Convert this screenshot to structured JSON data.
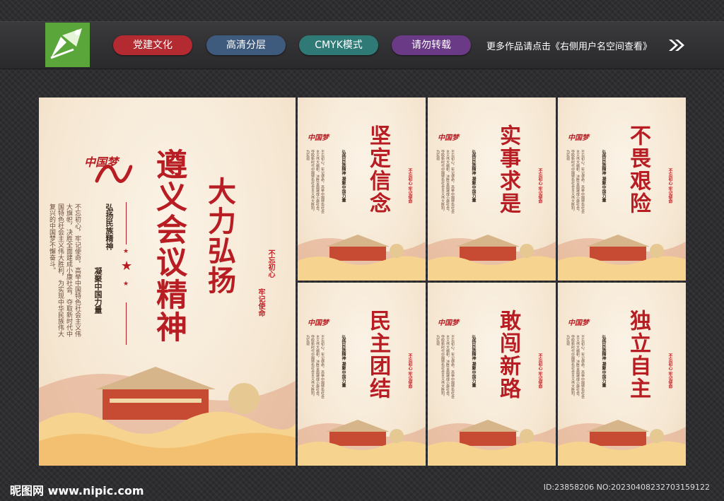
{
  "header": {
    "tags": [
      {
        "label": "党建文化",
        "color": "#b32a30"
      },
      {
        "label": "高清分层",
        "color": "#3e5a7d"
      },
      {
        "label": "CMYK模式",
        "color": "#2f7a77"
      },
      {
        "label": "请勿转载",
        "color": "#6b3a86"
      }
    ],
    "more_text": "更多作品请点击《右侧用户名空间查看》"
  },
  "main_poster": {
    "headline_left": "遵义会议精神",
    "headline_right": "大力弘扬",
    "calligraphy": "中国梦",
    "subtitle_a": "弘扬民族精神",
    "subtitle_b": "凝聚中国力量",
    "body": "不忘初心，牢记使命，高举中国特色社会主义伟大旗帜，决胜全面建成小康社会，夺取新时代中国特色社会主义伟大胜利，为实现中华民族伟大复兴的中国梦不懈奋斗。",
    "slogan_a": "不忘初心",
    "slogan_b": "牢记使命"
  },
  "small_posters": [
    {
      "title": "坚定信念"
    },
    {
      "title": "实事求是"
    },
    {
      "title": "不畏艰险"
    },
    {
      "title": "民主团结"
    },
    {
      "title": "敢闯新路"
    },
    {
      "title": "独立自主"
    }
  ],
  "small_common": {
    "subtitle": "弘扬民族精神 凝聚中国力量",
    "body": "不忘初心，牢记使命，高举中国特色社会主义伟大旗帜，决胜全面建成小康社会，夺取新时代中国特色社会主义伟大胜利，为实现",
    "slogan": "不忘初心 牢记使命",
    "calligraphy": "中国梦"
  },
  "footer": {
    "site": "昵图网 www.nipic.com",
    "id_text": "ID:23858206 NO:20230408232703159122"
  }
}
